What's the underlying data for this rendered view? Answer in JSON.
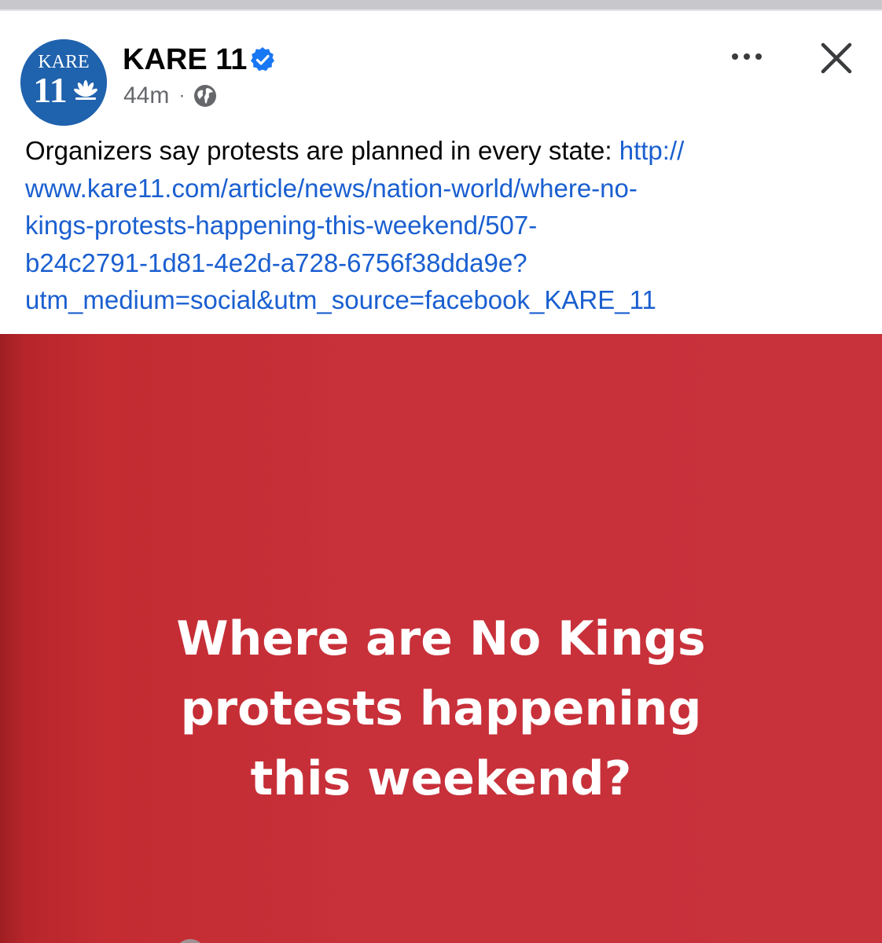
{
  "post": {
    "page_name": "KARE 11",
    "avatar_text_top": "KARE",
    "avatar_text_num": "11",
    "timestamp": "44m",
    "separator": "·",
    "audience_icon": "globe-icon",
    "verified_icon": "verified-badge-icon",
    "more_icon": "more-options-icon",
    "close_icon": "close-icon",
    "text_prefix": "Organizers say protests are planned in every state: ",
    "link_lines": [
      "http://",
      "www.kare11.com/article/news/nation-world/where-no-",
      "kings-protests-happening-this-weekend/507-",
      "b24c2791-1d81-4e2d-a728-6756f38dda9e?",
      "utm_medium=social&utm_source=facebook_KARE_11"
    ]
  },
  "media": {
    "headline_lines": [
      "Where are No Kings",
      "protests happening",
      "this weekend?"
    ]
  },
  "colors": {
    "link": "#1a5fd0",
    "verified": "#1877f2",
    "avatar_bg": "#1f62ad",
    "media_bg": "#c8323b",
    "meta_text": "#65676b"
  }
}
